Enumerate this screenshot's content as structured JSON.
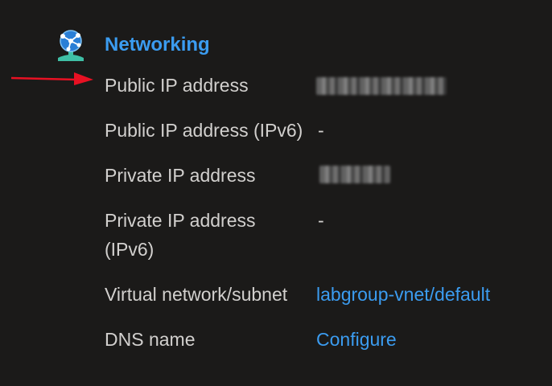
{
  "section": {
    "title": "Networking",
    "icon": "networking-icon"
  },
  "annotation": {
    "arrow_color": "#e81123"
  },
  "colors": {
    "background": "#1b1a19",
    "text": "#d2d0ce",
    "accent": "#3b9cf0"
  },
  "properties": [
    {
      "label": "Public IP address",
      "value": "",
      "redacted": true
    },
    {
      "label": "Public IP address (IPv6)",
      "value": "-"
    },
    {
      "label": "Private IP address",
      "value": "",
      "redacted": true
    },
    {
      "label": "Private IP address (IPv6)",
      "value": "-"
    },
    {
      "label": "Virtual network/subnet",
      "value": "labgroup-vnet/default",
      "link": true
    },
    {
      "label": "DNS name",
      "value": "Configure",
      "link": true
    }
  ]
}
